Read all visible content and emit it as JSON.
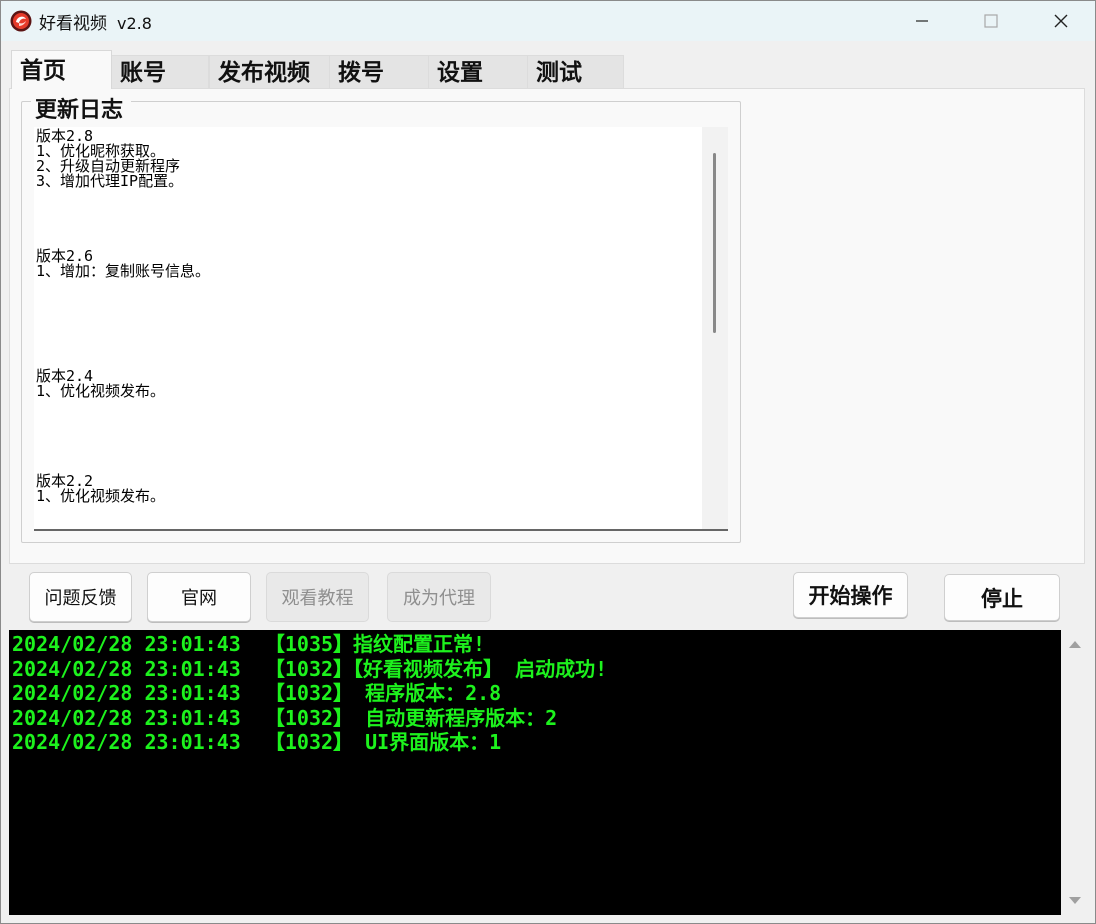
{
  "window": {
    "title": "好看视频",
    "version": "v2.8",
    "icons": {
      "app": "app-logo-icon",
      "minimize": "minimize-icon",
      "maximize": "maximize-icon",
      "close": "close-icon"
    }
  },
  "tabs": [
    {
      "label": "首页",
      "active": true
    },
    {
      "label": "账号",
      "active": false
    },
    {
      "label": "发布视频",
      "active": false
    },
    {
      "label": "拨号",
      "active": false
    },
    {
      "label": "设置",
      "active": false
    },
    {
      "label": "测试",
      "active": false
    }
  ],
  "changelog": {
    "title": "更新日志",
    "text": "版本2.8\n1、优化昵称获取。\n2、升级自动更新程序\n3、增加代理IP配置。\n\n\n\n\n版本2.6\n1、增加：复制账号信息。\n\n\n\n\n\n\n版本2.4\n1、优化视频发布。\n\n\n\n\n\n版本2.2\n1、优化视频发布。"
  },
  "buttons": {
    "feedback": "问题反馈",
    "website": "官网",
    "tutorial": "观看教程",
    "agent": "成为代理",
    "start": "开始操作",
    "stop": "停止"
  },
  "console": {
    "text_color": "#1df21d",
    "lines": [
      "2024/02/28 23:01:43  【1035】指纹配置正常!",
      "2024/02/28 23:01:43  【1032】【好看视频发布】 启动成功!",
      "2024/02/28 23:01:43  【1032】 程序版本：2.8",
      "2024/02/28 23:01:43  【1032】 自动更新程序版本：2",
      "2024/02/28 23:01:43  【1032】 UI界面版本：1"
    ]
  }
}
